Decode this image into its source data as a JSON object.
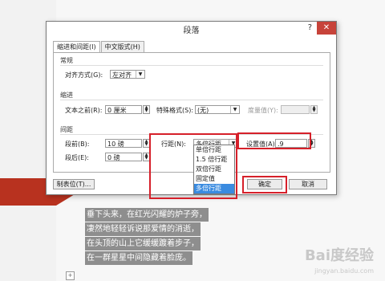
{
  "document": {
    "lines": [
      "垂下头来，在红光闪耀的炉子旁，",
      "凄然地轻轻诉说那爱情的消逝，",
      "在头顶的山上它缓缓踱着步子，",
      "在一群星星中间隐藏着脸庞。"
    ],
    "page_marker": "+",
    "watermark": "Bai度经验",
    "watermark_sub": "jingyan.baidu.com"
  },
  "dialog": {
    "title": "段落",
    "help": "?",
    "close": "✕",
    "tabs": [
      "缩进和间距(I)",
      "中文版式(H)"
    ],
    "general": {
      "section": "常规",
      "alignment_label": "对齐方式(G):",
      "alignment_value": "左对齐"
    },
    "indent": {
      "section": "缩进",
      "before_text_label": "文本之前(R):",
      "before_text_value": "0 厘米",
      "special_label": "特殊格式(S):",
      "special_value": "(无)",
      "by_label": "度量值(Y):",
      "by_value": ""
    },
    "spacing": {
      "section": "间距",
      "before_label": "段前(B):",
      "before_value": "10 磅",
      "after_label": "段后(E):",
      "after_value": "0 磅",
      "line_spacing_label": "行距(N):",
      "line_spacing_value": "多倍行距",
      "set_at_label": "设置值(A)",
      "set_at_value": ".9"
    },
    "line_spacing_options": [
      "单倍行距",
      "1.5 倍行距",
      "双倍行距",
      "固定值",
      "多倍行距"
    ],
    "selected_option_index": 4,
    "buttons": {
      "tabs": "制表位(T)...",
      "ok": "确定",
      "cancel": "取消"
    }
  },
  "colors": {
    "highlight_frame": "#d6202a",
    "selection": "#3a8be0",
    "accent_shape": "#b8321f"
  }
}
